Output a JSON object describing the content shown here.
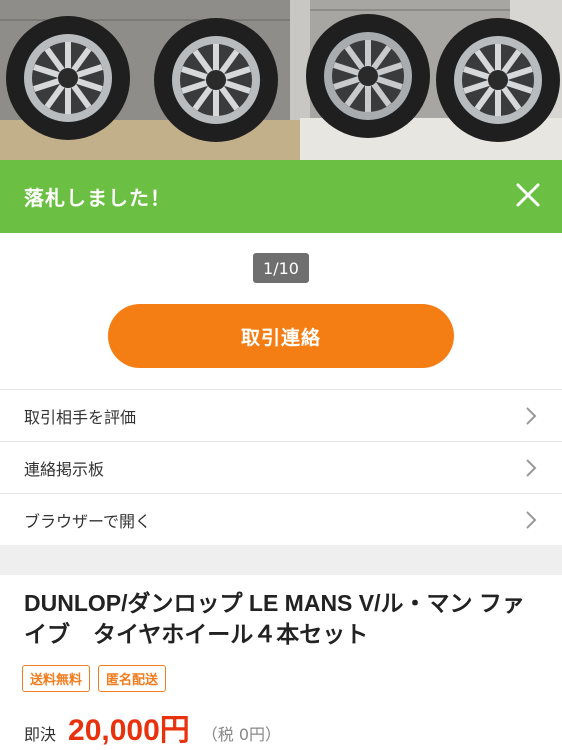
{
  "photo": {
    "alt": "tire-wheel-set-photo"
  },
  "banner": {
    "title": "落札しました！"
  },
  "counter": {
    "text": "1/10"
  },
  "contact_button": {
    "label": "取引連絡"
  },
  "menu": {
    "items": [
      {
        "label": "取引相手を評価"
      },
      {
        "label": "連絡掲示板"
      },
      {
        "label": "ブラウザーで開く"
      }
    ]
  },
  "item": {
    "title": "DUNLOP/ダンロップ LE MANS V/ル・マン ファイブ　タイヤホイール４本セット",
    "badges": [
      "送料無料",
      "匿名配送"
    ],
    "price_label": "即決",
    "price": "20,000円",
    "tax": "（税 0円）"
  },
  "colors": {
    "banner": "#6bbf43",
    "button": "#f57e14",
    "price": "#e8320e",
    "badge": "#f07d1e"
  }
}
